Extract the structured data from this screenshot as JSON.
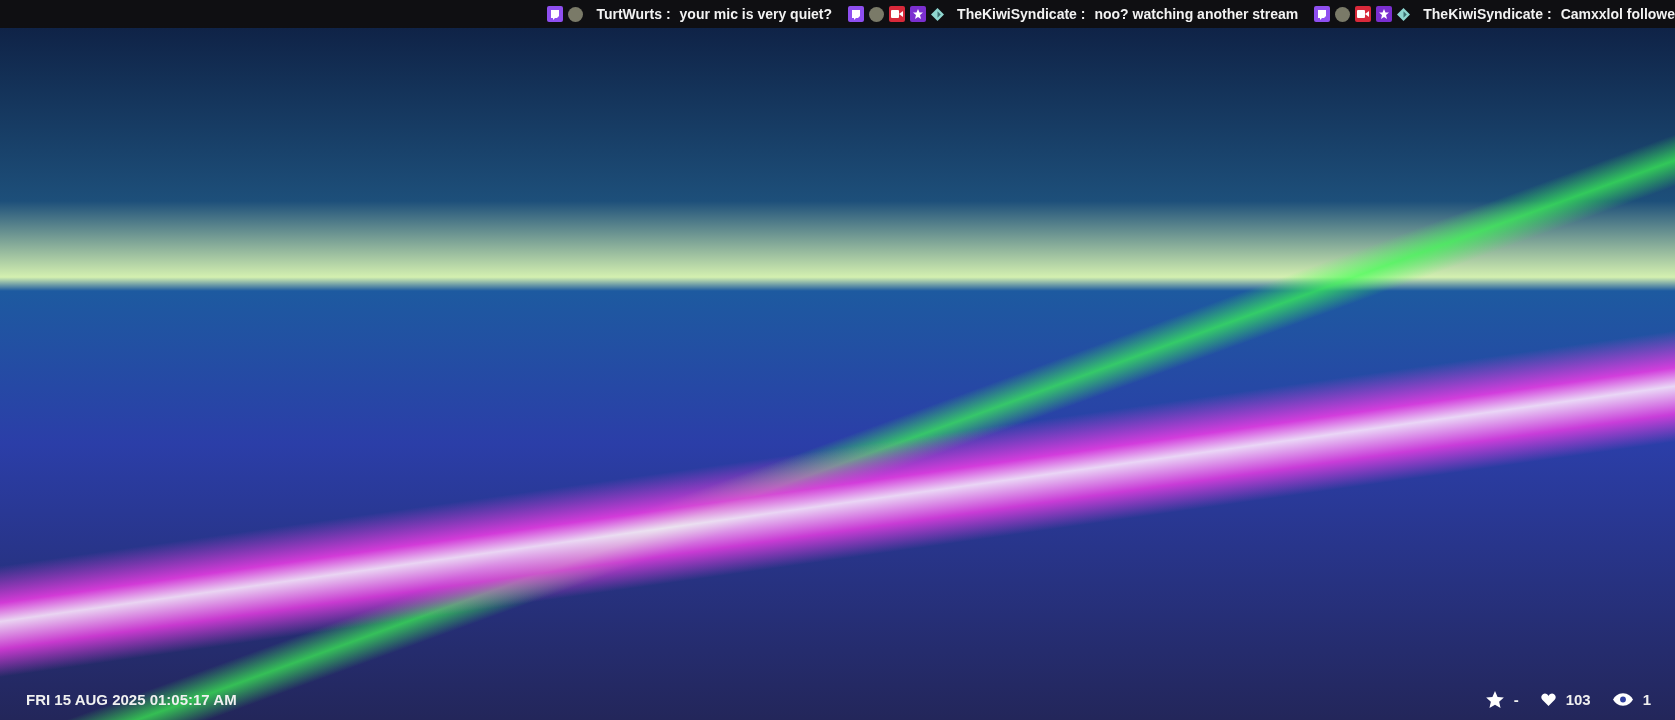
{
  "ticker": {
    "messages": [
      {
        "badges": [
          {
            "kind": "platform"
          },
          {
            "kind": "avatar"
          }
        ],
        "user": "TurtWurts",
        "separator": ":",
        "text": "your mic is very quiet?"
      },
      {
        "badges": [
          {
            "kind": "platform"
          },
          {
            "kind": "avatar"
          },
          {
            "kind": "camera"
          },
          {
            "kind": "star"
          },
          {
            "kind": "gem"
          }
        ],
        "user": "TheKiwiSyndicate",
        "separator": ":",
        "text": "noo?  watching another stream"
      },
      {
        "badges": [
          {
            "kind": "platform"
          },
          {
            "kind": "avatar"
          },
          {
            "kind": "camera"
          },
          {
            "kind": "star"
          },
          {
            "kind": "gem"
          }
        ],
        "user": "TheKiwiSyndicate",
        "separator": ":",
        "text": "Camxxlol followe"
      }
    ]
  },
  "footer": {
    "datetime": "FRI 15 AUG 2025 01:05:17 AM",
    "stats": [
      {
        "kind": "star",
        "value": "-"
      },
      {
        "kind": "heart",
        "value": "103"
      },
      {
        "kind": "viewers",
        "value": "1"
      }
    ]
  }
}
